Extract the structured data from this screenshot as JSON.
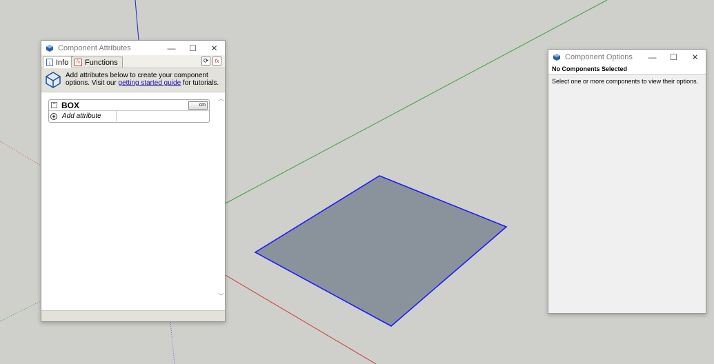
{
  "attributes_window": {
    "title": "Component Attributes",
    "tabs": [
      {
        "label": "Info",
        "icon": "info-icon"
      },
      {
        "label": "Functions",
        "icon": "fx-icon"
      }
    ],
    "info_text_before": "Add attributes below to create your component options. Visit our ",
    "info_link": "getting started guide",
    "info_text_after": " for tutorials.",
    "component": {
      "name": "BOX",
      "unit": "cm",
      "add_attribute_label": "Add attribute"
    }
  },
  "options_window": {
    "title": "Component Options",
    "header": "No Components Selected",
    "message": "Select one or more components to view their options."
  },
  "window_controls": {
    "minimize": "—",
    "maximize": "☐",
    "close": "✕"
  },
  "colors": {
    "background": "#cfd0cb",
    "face": "#8a939b",
    "face_edge": "#1a1aff",
    "red_axis": "#d03030",
    "green_axis": "#3aa03a",
    "blue_axis": "#2020c0"
  }
}
